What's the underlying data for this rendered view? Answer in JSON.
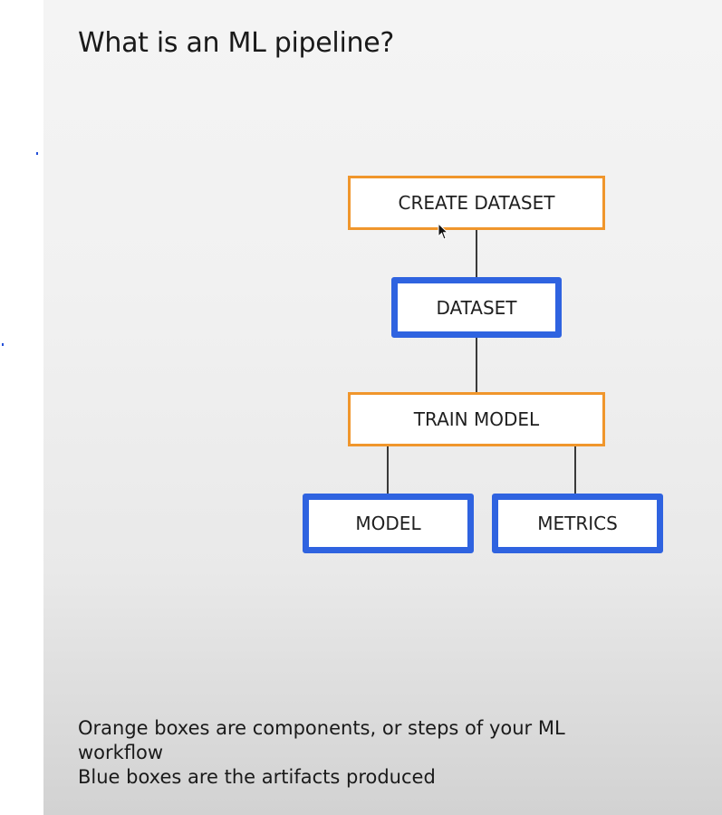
{
  "slide": {
    "title": "What is an ML pipeline?",
    "footer_lines": [
      "Orange boxes are components, or steps of your ML",
      "workflow",
      "Blue boxes are the artifacts produced"
    ]
  },
  "diagram": {
    "nodes": {
      "create_dataset": {
        "label": "CREATE DATASET",
        "kind": "component"
      },
      "dataset": {
        "label": "DATASET",
        "kind": "artifact"
      },
      "train_model": {
        "label": "TRAIN MODEL",
        "kind": "component"
      },
      "model": {
        "label": "MODEL",
        "kind": "artifact"
      },
      "metrics": {
        "label": "METRICS",
        "kind": "artifact"
      }
    },
    "edges": [
      [
        "create_dataset",
        "dataset"
      ],
      [
        "dataset",
        "train_model"
      ],
      [
        "train_model",
        "model"
      ],
      [
        "train_model",
        "metrics"
      ]
    ]
  },
  "colors": {
    "component_border": "#f0962c",
    "artifact_border": "#2f63e0",
    "connector": "#3a3a3a"
  },
  "icons": {
    "cursor": "mouse-pointer-icon"
  }
}
